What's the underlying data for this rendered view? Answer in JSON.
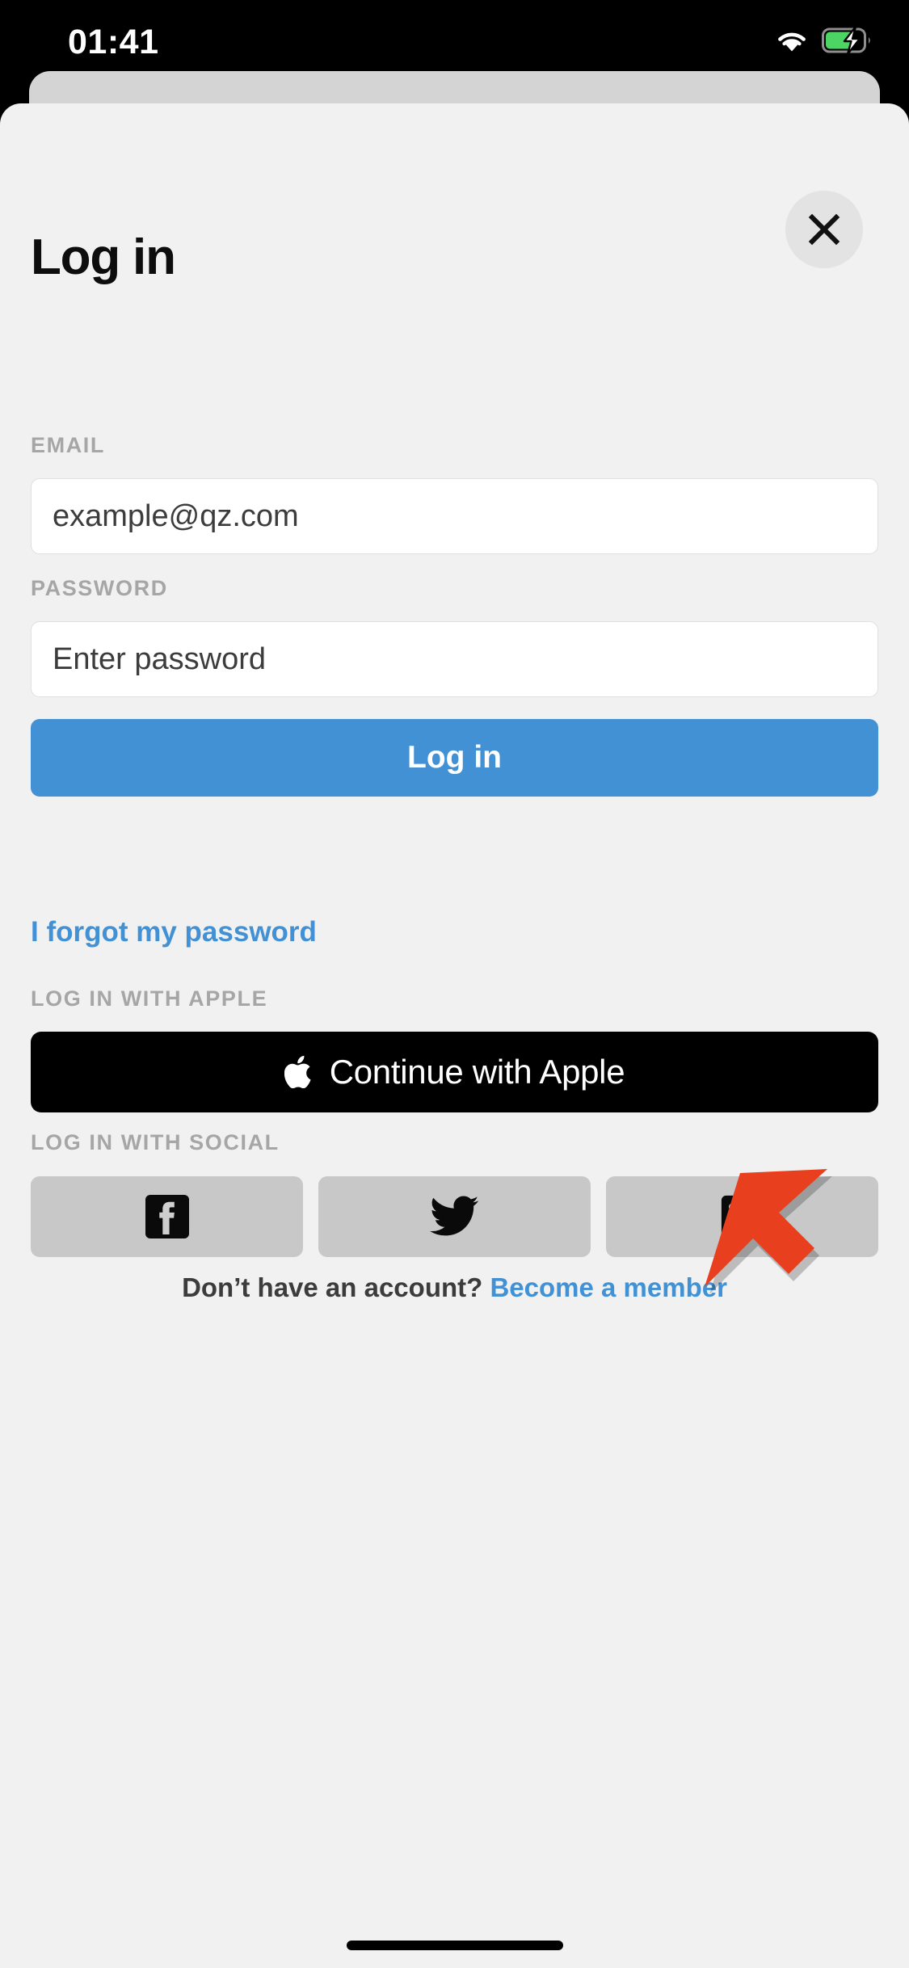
{
  "status_bar": {
    "time": "01:41",
    "wifi_icon": "wifi-icon",
    "battery_icon": "battery-charging-icon",
    "battery_color": "#4cd562"
  },
  "sheet": {
    "close_icon": "close-icon",
    "title": "Log in",
    "background": "#f1f1f1"
  },
  "form": {
    "email": {
      "label": "EMAIL",
      "value": "example@qz.com",
      "placeholder": "example@qz.com"
    },
    "password": {
      "label": "PASSWORD",
      "value": "",
      "placeholder": "Enter password"
    },
    "submit_label": "Log in",
    "submit_color": "#4191d4",
    "forgot_link": "I forgot my password"
  },
  "apple": {
    "section_label": "LOG IN WITH APPLE",
    "button_label": "Continue with Apple",
    "icon": "apple-logo-icon",
    "button_color": "#000000"
  },
  "social": {
    "section_label": "LOG IN WITH SOCIAL",
    "buttons": [
      {
        "name": "facebook",
        "icon": "facebook-icon"
      },
      {
        "name": "twitter",
        "icon": "twitter-icon"
      },
      {
        "name": "linkedin",
        "icon": "linkedin-icon"
      }
    ],
    "button_color": "#c8c8c8"
  },
  "footer": {
    "question": "Don’t have an account?",
    "link": "Become a member",
    "link_color": "#4191d4"
  },
  "annotation": {
    "arrow_icon": "red-arrow-pointer-icon",
    "arrow_color": "#e8401f",
    "points_at": "Continue with Apple"
  }
}
